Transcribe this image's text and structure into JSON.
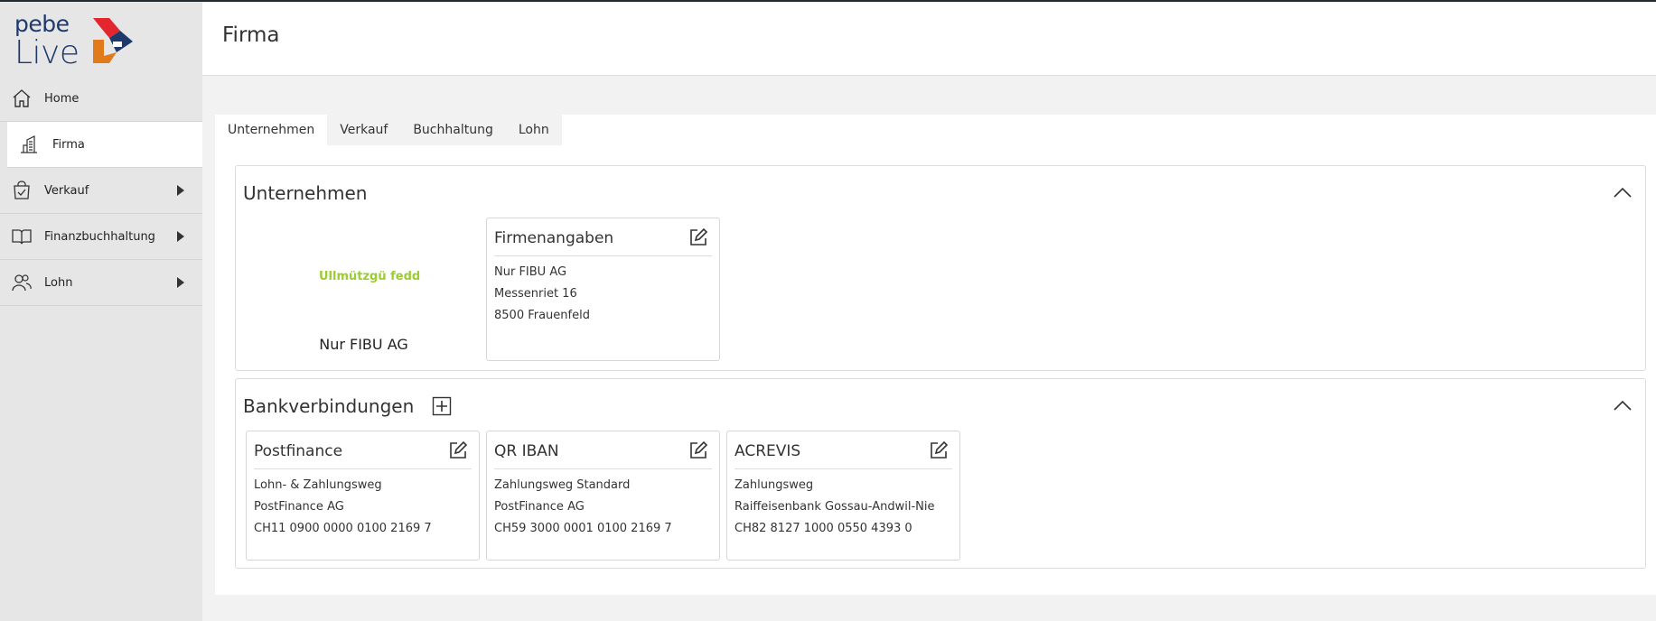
{
  "app": {
    "logo_text_top": "pebe",
    "logo_text_bottom": "Live"
  },
  "sidebar": {
    "items": [
      {
        "label": "Home",
        "icon": "home-icon",
        "active": false,
        "expandable": false
      },
      {
        "label": "Firma",
        "icon": "building-icon",
        "active": true,
        "expandable": false
      },
      {
        "label": "Verkauf",
        "icon": "shopping-bag-icon",
        "active": false,
        "expandable": true
      },
      {
        "label": "Finanzbuchhaltung",
        "icon": "book-icon",
        "active": false,
        "expandable": true
      },
      {
        "label": "Lohn",
        "icon": "users-icon",
        "active": false,
        "expandable": true
      }
    ]
  },
  "header": {
    "title": "Firma"
  },
  "tabs": [
    {
      "label": "Unternehmen",
      "active": true
    },
    {
      "label": "Verkauf",
      "active": false
    },
    {
      "label": "Buchhaltung",
      "active": false
    },
    {
      "label": "Lohn",
      "active": false
    }
  ],
  "unternehmen": {
    "title": "Unternehmen",
    "logo_text": "Ullmützgü fedd",
    "company_name": "Nur FIBU AG",
    "card": {
      "title": "Firmenangaben",
      "lines": [
        "Nur FIBU AG",
        "Messenriet 16",
        "8500 Frauenfeld"
      ]
    }
  },
  "bankverbindungen": {
    "title": "Bankverbindungen",
    "cards": [
      {
        "title": "Postfinance",
        "lines": [
          "Lohn- & Zahlungsweg",
          "PostFinance AG",
          "CH11 0900 0000 0100 2169 7"
        ]
      },
      {
        "title": "QR IBAN",
        "lines": [
          "Zahlungsweg Standard",
          "PostFinance AG",
          "CH59 3000 0001 0100 2169 7"
        ]
      },
      {
        "title": "ACREVIS",
        "lines": [
          "Zahlungsweg",
          "Raiffeisenbank Gossau-Andwil-Nie",
          "CH82 8127 1000 0550 4393 0"
        ]
      }
    ]
  },
  "colors": {
    "brand_blue": "#1e3a6d",
    "logo_red": "#e3262e",
    "logo_orange": "#e07a1a",
    "sidebar_bg": "#e6e6e6",
    "content_bg": "#f2f2f2",
    "logo_img_green": "#9acd32"
  }
}
